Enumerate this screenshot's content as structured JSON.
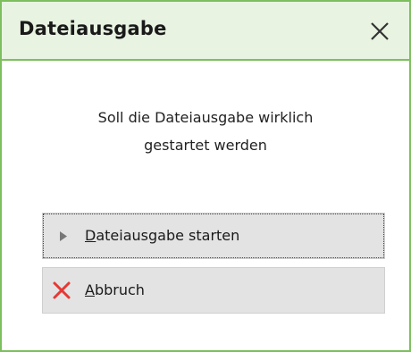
{
  "dialog": {
    "title": "Dateiausgabe",
    "message_line1": "Soll die Dateiausgabe wirklich",
    "message_line2": "gestartet werden",
    "buttons": {
      "start": {
        "label": "Dateiausgabe starten",
        "icon": "play-arrow-icon"
      },
      "cancel": {
        "label": "Abbruch",
        "icon": "red-x-icon"
      }
    },
    "close_icon": "close-icon"
  },
  "colors": {
    "frame_border": "#7dbf5e",
    "titlebar_bg": "#e8f3e1",
    "button_bg": "#e3e3e3",
    "cancel_icon": "#e53935"
  }
}
